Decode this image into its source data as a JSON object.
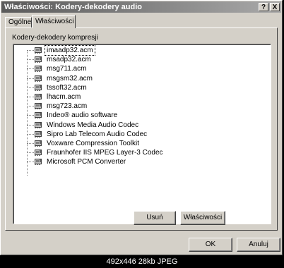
{
  "window": {
    "title": "Właściwości: Kodery-dekodery audio",
    "help_label": "?",
    "close_label": "X"
  },
  "tabs": [
    {
      "label": "Ogólne",
      "active": false
    },
    {
      "label": "Właściwości",
      "active": true
    }
  ],
  "group": {
    "label": "Kodery-dekodery kompresji"
  },
  "codecs": [
    "imaadp32.acm",
    "msadp32.acm",
    "msg711.acm",
    "msgsm32.acm",
    "tssoft32.acm",
    "lhacm.acm",
    "msg723.acm",
    "Indeo® audio software",
    "Windows Media Audio Codec",
    "Sipro Lab Telecom Audio Codec",
    "Voxware Compression Toolkit",
    "Fraunhofer IIS MPEG Layer-3 Codec",
    "Microsoft PCM Converter"
  ],
  "buttons": {
    "remove": "Usuń",
    "properties": "Właściwości",
    "ok": "OK",
    "cancel": "Anuluj"
  },
  "footer": {
    "info": "492x446 28kb JPEG"
  },
  "colors": {
    "face": "#d4d0c8",
    "titlebar": "#5a5a5a"
  }
}
